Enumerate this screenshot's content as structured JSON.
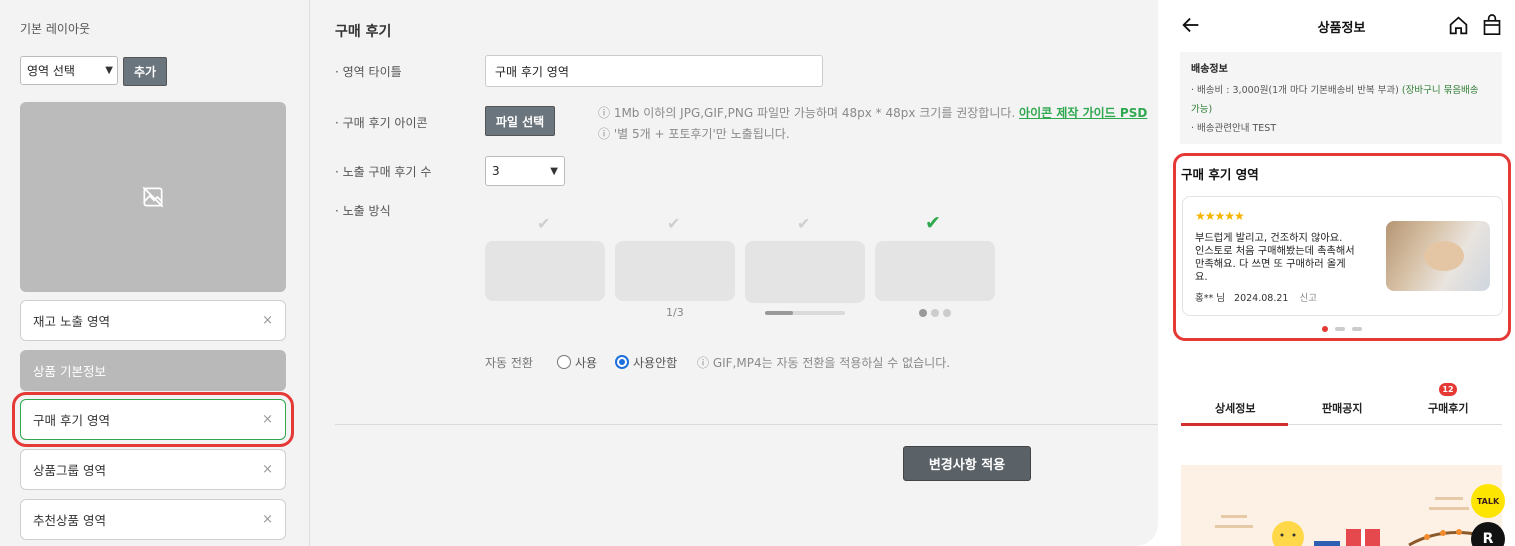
{
  "left": {
    "section_label": "기본 레이아웃",
    "area_select": "영역 선택",
    "add_button": "추가",
    "areas": [
      {
        "label": "재고 노출 영역",
        "remove": "×"
      },
      {
        "label": "상품 기본정보"
      },
      {
        "label": "구매 후기 영역",
        "remove": "×"
      },
      {
        "label": "상품그룹 영역",
        "remove": "×"
      },
      {
        "label": "추천상품 영역",
        "remove": "×"
      }
    ]
  },
  "form": {
    "title": "구매 후기",
    "title_label": "· 영역 타이틀",
    "title_value": "구매 후기 영역",
    "icon_label": "· 구매 후기 아이콘",
    "file_button": "파일 선택",
    "hint_size": "ⓘ 1Mb 이하의 JPG,GIF,PNG 파일만 가능하며 48px * 48px 크기를 권장합니다.",
    "hint_guide_link": "아이콘 제작 가이드 PSD",
    "hint_stars": "ⓘ '별 5개 + 포토후기'만 노출됩니다.",
    "count_label": "· 노출 구매 후기 수",
    "count_value": "3",
    "mode_label": "· 노출 방식",
    "mode_caption_page": "1/3",
    "mode_progress": 0.35,
    "auto_label": "자동 전환",
    "radio_use": "사용",
    "radio_nouse": "사용안함",
    "auto_hint": "ⓘ GIF,MP4는 자동 전환을 적용하실 수 없습니다.",
    "apply_button": "변경사항 적용"
  },
  "mobile": {
    "header_title": "상품정보",
    "shipping_title": "배송정보",
    "shipping_fee": "· 배송비 : 3,000원(1개 마다 기본배송비 반복 부과)",
    "shipping_fee_note": "(장바구니 묶음배송",
    "shipping_fee_note2": "가능)",
    "shipping_guide": "· 배송관련안내 TEST",
    "review_title": "구매 후기 영역",
    "review_stars": "★★★★★",
    "review_text": "부드럽게 발리고, 건조하지 않아요. 인스토로 처음 구매해봤는데 촉촉해서 만족해요. 다 쓰면 또 구매하러 올게요.",
    "review_author": "홍** 님",
    "review_date": "2024.08.21",
    "review_report": "신고",
    "tabs": [
      "상세정보",
      "판매공지",
      "구매후기"
    ],
    "review_count_badge": "12",
    "talk_label": "TALK",
    "r_label": "R"
  }
}
